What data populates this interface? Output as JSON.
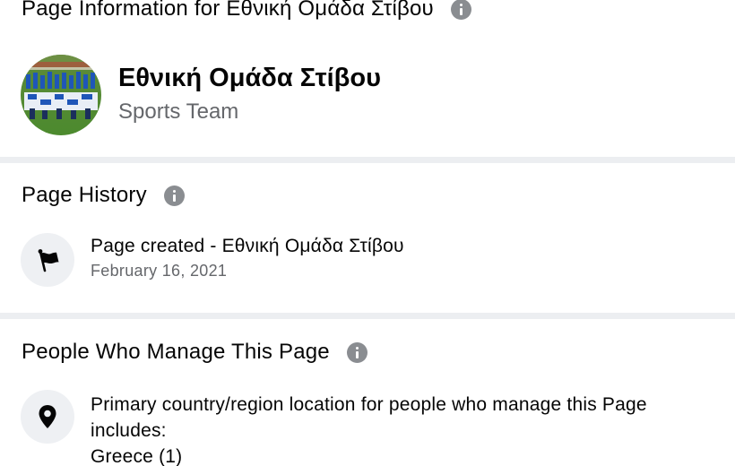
{
  "header": {
    "title": "Page Information for Εθνική Ομάδα Στίβου",
    "info_icon": "info-icon"
  },
  "profile": {
    "name": "Εθνική Ομάδα Στίβου",
    "category": "Sports Team",
    "avatar": "team-photo-avatar"
  },
  "page_history": {
    "heading": "Page History",
    "info_icon": "info-icon",
    "items": [
      {
        "icon": "flag-icon",
        "title": "Page created - Εθνική Ομάδα Στίβου",
        "date": "February 16, 2021"
      }
    ]
  },
  "managers": {
    "heading": "People Who Manage This Page",
    "info_icon": "info-icon",
    "items": [
      {
        "icon": "location-pin-icon",
        "text": "Primary country/region location for people who manage this Page includes:",
        "value": "Greece (1)"
      }
    ]
  },
  "colors": {
    "text": "#050505",
    "secondary_text": "#65676b",
    "info_icon": "#8a8d91",
    "divider": "#eceef1",
    "icon_bg": "#eef0f3"
  }
}
